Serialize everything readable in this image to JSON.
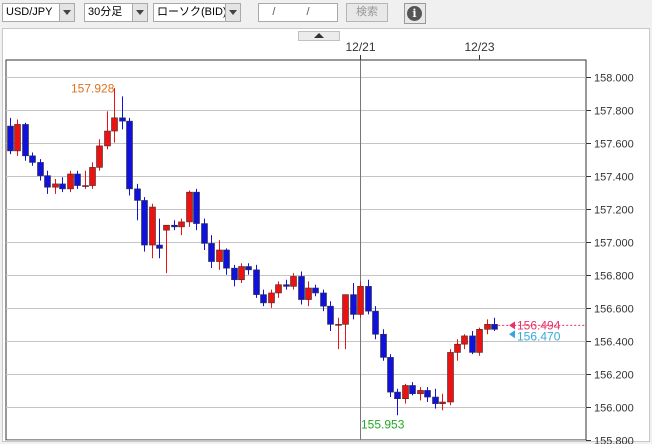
{
  "toolbar": {
    "pair": "USD/JPY",
    "interval": "30分足",
    "chart_kind": "ローソク(BID)",
    "date_placeholder": "/ /",
    "search_label": "検索",
    "info_glyph": "i"
  },
  "colors": {
    "up": "#ee1111",
    "down": "#1111dd",
    "high_label": "#e07020",
    "low_label": "#22aa22",
    "current_bid": "#e8336b",
    "current_ask": "#33aadd"
  },
  "chart_data": {
    "type": "candlestick",
    "title": "",
    "xlabel": "",
    "ylabel": "",
    "ylim": [
      155.8,
      158.1
    ],
    "y_ticks": [
      "158.000",
      "157.800",
      "157.600",
      "157.400",
      "157.200",
      "157.000",
      "156.800",
      "156.600",
      "156.400",
      "156.200",
      "156.000",
      "155.800"
    ],
    "x_ticks": [
      "12/21",
      "12/23"
    ],
    "grid": true,
    "high_label": "157.928",
    "low_label": "155.953",
    "current_bid": "156.494",
    "current_ask": "156.470",
    "candles": [
      [
        157.7,
        157.75,
        157.53,
        157.55
      ],
      [
        157.55,
        157.74,
        157.52,
        157.71
      ],
      [
        157.71,
        157.72,
        157.49,
        157.52
      ],
      [
        157.52,
        157.54,
        157.46,
        157.48
      ],
      [
        157.48,
        157.5,
        157.37,
        157.4
      ],
      [
        157.4,
        157.43,
        157.29,
        157.33
      ],
      [
        157.33,
        157.38,
        157.29,
        157.35
      ],
      [
        157.35,
        157.39,
        157.3,
        157.32
      ],
      [
        157.32,
        157.43,
        157.3,
        157.41
      ],
      [
        157.41,
        157.43,
        157.32,
        157.34
      ],
      [
        157.34,
        157.43,
        157.32,
        157.34
      ],
      [
        157.34,
        157.48,
        157.32,
        157.45
      ],
      [
        157.45,
        157.62,
        157.43,
        157.58
      ],
      [
        157.58,
        157.79,
        157.56,
        157.67
      ],
      [
        157.67,
        157.93,
        157.6,
        157.75
      ],
      [
        157.75,
        157.88,
        157.68,
        157.73
      ],
      [
        157.73,
        157.75,
        157.28,
        157.32
      ],
      [
        157.32,
        157.35,
        157.13,
        157.25
      ],
      [
        157.25,
        157.27,
        156.94,
        156.98
      ],
      [
        156.98,
        157.23,
        156.9,
        157.21
      ],
      [
        156.98,
        157.14,
        156.9,
        156.96
      ],
      [
        157.07,
        157.1,
        156.81,
        157.1
      ],
      [
        157.1,
        157.13,
        157.07,
        157.09
      ],
      [
        157.09,
        157.14,
        157.04,
        157.12
      ],
      [
        157.12,
        157.31,
        157.09,
        157.3
      ],
      [
        157.3,
        157.32,
        157.07,
        157.11
      ],
      [
        157.11,
        157.14,
        156.95,
        156.99
      ],
      [
        156.99,
        157.04,
        156.84,
        156.88
      ],
      [
        156.88,
        157.01,
        156.83,
        156.95
      ],
      [
        156.95,
        156.96,
        156.8,
        156.84
      ],
      [
        156.84,
        156.86,
        156.73,
        156.77
      ],
      [
        156.77,
        156.87,
        156.75,
        156.85
      ],
      [
        156.85,
        156.87,
        156.8,
        156.83
      ],
      [
        156.83,
        156.86,
        156.66,
        156.68
      ],
      [
        156.68,
        156.71,
        156.61,
        156.63
      ],
      [
        156.63,
        156.71,
        156.6,
        156.69
      ],
      [
        156.69,
        156.76,
        156.66,
        156.74
      ],
      [
        156.74,
        156.77,
        156.71,
        156.73
      ],
      [
        156.73,
        156.81,
        156.71,
        156.79
      ],
      [
        156.79,
        156.82,
        156.62,
        156.65
      ],
      [
        156.65,
        156.76,
        156.61,
        156.72
      ],
      [
        156.72,
        156.74,
        156.67,
        156.69
      ],
      [
        156.69,
        156.71,
        156.58,
        156.61
      ],
      [
        156.61,
        156.64,
        156.46,
        156.5
      ],
      [
        156.5,
        156.54,
        156.35,
        156.5
      ],
      [
        156.5,
        156.68,
        156.35,
        156.68
      ],
      [
        156.68,
        156.75,
        156.53,
        156.56
      ],
      [
        156.56,
        156.76,
        156.54,
        156.73
      ],
      [
        156.73,
        156.77,
        156.56,
        156.58
      ],
      [
        156.58,
        156.61,
        156.41,
        156.44
      ],
      [
        156.44,
        156.47,
        156.28,
        156.3
      ],
      [
        156.3,
        156.32,
        156.06,
        156.09
      ],
      [
        156.09,
        156.11,
        155.95,
        156.05
      ],
      [
        156.05,
        156.14,
        156.02,
        156.13
      ],
      [
        156.13,
        156.15,
        156.07,
        156.08
      ],
      [
        156.08,
        156.12,
        156.04,
        156.1
      ],
      [
        156.1,
        156.12,
        156.03,
        156.06
      ],
      [
        156.06,
        156.11,
        155.99,
        156.02
      ],
      [
        156.02,
        156.08,
        155.98,
        156.03
      ],
      [
        156.03,
        156.35,
        156.01,
        156.33
      ],
      [
        156.33,
        156.41,
        156.28,
        156.38
      ],
      [
        156.38,
        156.44,
        156.35,
        156.43
      ],
      [
        156.43,
        156.46,
        156.32,
        156.33
      ],
      [
        156.33,
        156.48,
        156.31,
        156.47
      ],
      [
        156.47,
        156.53,
        156.44,
        156.5
      ],
      [
        156.5,
        156.54,
        156.46,
        156.47
      ]
    ]
  }
}
